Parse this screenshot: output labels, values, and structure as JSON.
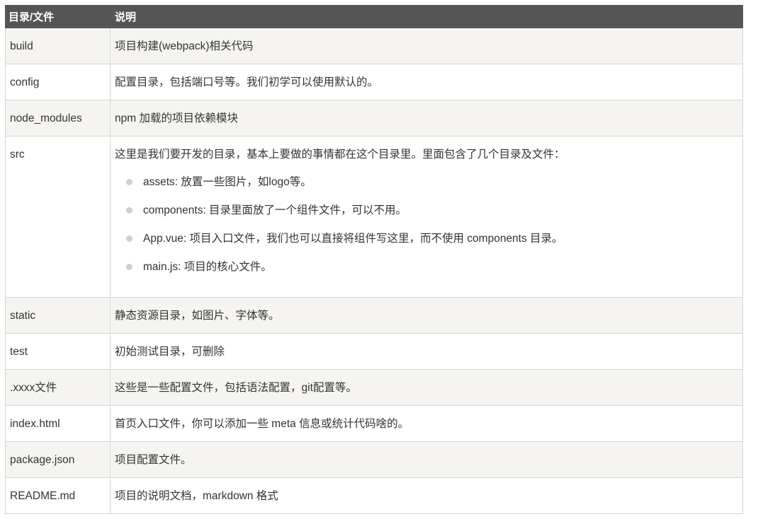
{
  "header": {
    "col1": "目录/文件",
    "col2": "说明"
  },
  "rows": [
    {
      "name": "build",
      "desc": "项目构建(webpack)相关代码"
    },
    {
      "name": "config",
      "desc": "配置目录，包括端口号等。我们初学可以使用默认的。"
    },
    {
      "name": "node_modules",
      "desc": "npm 加载的项目依赖模块"
    },
    {
      "name": "src",
      "desc": "这里是我们要开发的目录，基本上要做的事情都在这个目录里。里面包含了几个目录及文件：",
      "items": [
        "assets: 放置一些图片，如logo等。",
        "components: 目录里面放了一个组件文件，可以不用。",
        "App.vue: 项目入口文件，我们也可以直接将组件写这里，而不使用 components 目录。",
        "main.js: 项目的核心文件。"
      ]
    },
    {
      "name": "static",
      "desc": "静态资源目录，如图片、字体等。"
    },
    {
      "name": "test",
      "desc": "初始测试目录，可删除"
    },
    {
      "name": ".xxxx文件",
      "desc": "这些是一些配置文件，包括语法配置，git配置等。"
    },
    {
      "name": "index.html",
      "desc": "首页入口文件，你可以添加一些 meta 信息或统计代码啥的。"
    },
    {
      "name": "package.json",
      "desc": "项目配置文件。"
    },
    {
      "name": "README.md",
      "desc": "项目的说明文档，markdown 格式"
    }
  ]
}
